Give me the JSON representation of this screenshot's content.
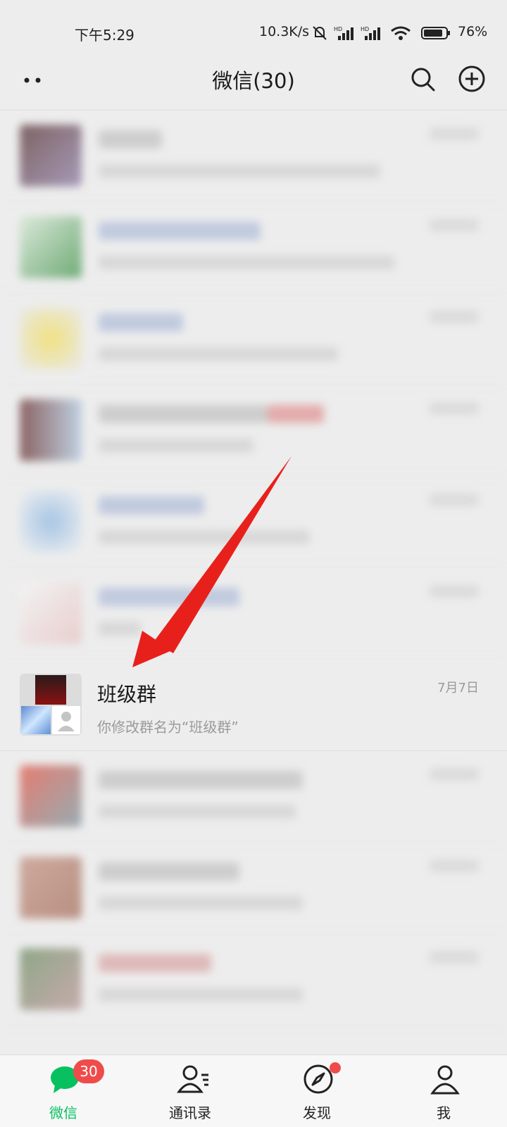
{
  "status": {
    "time": "下午5:29",
    "speed": "10.3K/s",
    "battery": "76%",
    "icons": [
      "mute-icon",
      "hd-signal-icon",
      "hd-signal-icon",
      "wifi-icon",
      "battery-icon"
    ]
  },
  "header": {
    "title": "微信(30)",
    "icons": [
      "more-dots-icon",
      "search-icon",
      "add-circle-icon"
    ]
  },
  "chat": {
    "name": "班级群",
    "preview": "你修改群名为“班级群”",
    "time": "7月7日"
  },
  "tabs": [
    {
      "label": "微信",
      "badge": "30",
      "active": true,
      "icon": "chat-bubble-icon"
    },
    {
      "label": "通讯录",
      "icon": "contacts-icon"
    },
    {
      "label": "发现",
      "icon": "compass-icon"
    },
    {
      "label": "我",
      "icon": "person-icon"
    }
  ],
  "colors": {
    "accent": "#07c160",
    "badge": "#f04b4b",
    "arrow": "#e8201c"
  }
}
